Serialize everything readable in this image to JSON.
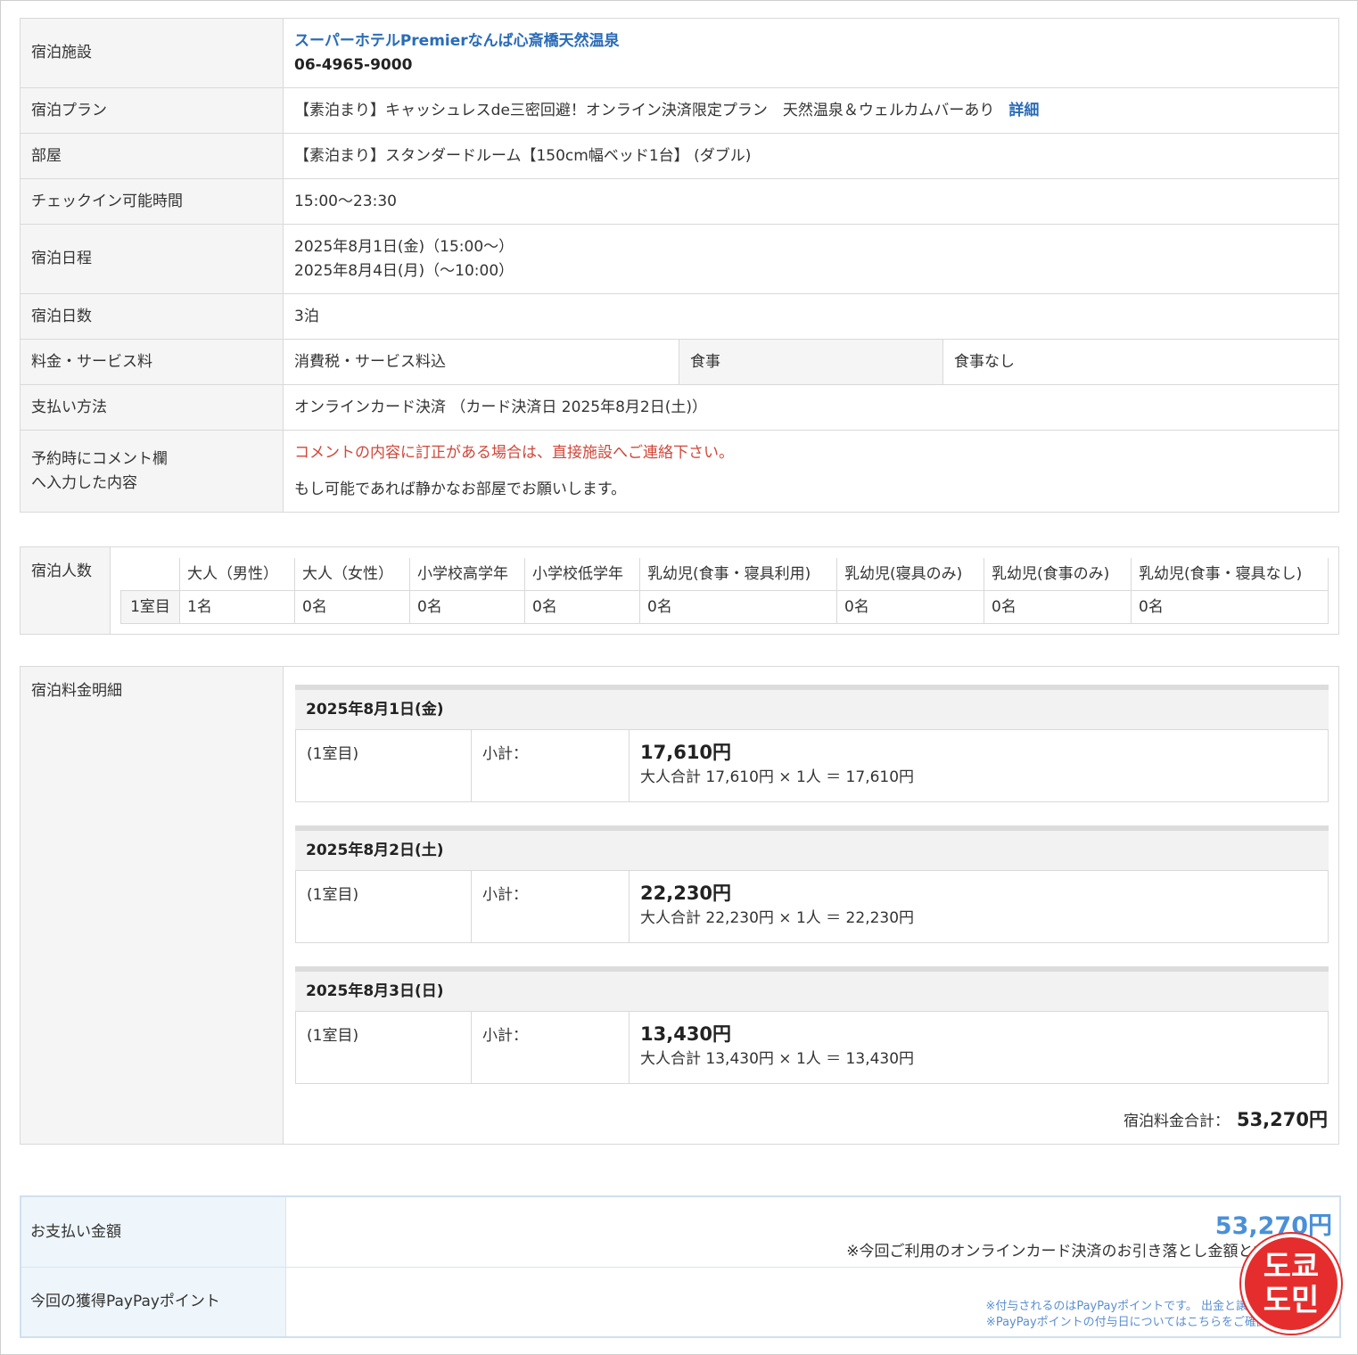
{
  "info": {
    "facility_label": "宿泊施設",
    "hotel_name": "スーパーホテルPremierなんば心斎橋天然温泉",
    "hotel_tel": "06-4965-9000",
    "plan_label": "宿泊プラン",
    "plan_value": "【素泊まり】キャッシュレスde三密回避！オンライン決済限定プラン　天然温泉＆ウェルカムバーあり",
    "plan_detail_link": "詳細",
    "room_label": "部屋",
    "room_value": "【素泊まり】スタンダードルーム【150cm幅ベッド1台】 (ダブル)",
    "checkin_label": "チェックイン可能時間",
    "checkin_value": "15:00～23:30",
    "schedule_label": "宿泊日程",
    "schedule_start": "2025年8月1日(金)（15:00～）",
    "schedule_end": "2025年8月4日(月)（～10:00）",
    "nights_label": "宿泊日数",
    "nights_value": "3泊",
    "fee_label": "料金・サービス料",
    "fee_value": "消費税・サービス料込",
    "meal_label": "食事",
    "meal_value": "食事なし",
    "payment_label": "支払い方法",
    "payment_value": "オンラインカード決済 （カード決済日 2025年8月2日(土)）",
    "comment_label_1": "予約時にコメント欄",
    "comment_label_2": "へ入力した内容",
    "comment_warning": "コメントの内容に訂正がある場合は、直接施設へご連絡下さい。",
    "comment_value": "もし可能であれば静かなお部屋でお願いします。"
  },
  "guests": {
    "label": "宿泊人数",
    "headers": [
      "大人（男性）",
      "大人（女性）",
      "小学校高学年",
      "小学校低学年",
      "乳幼児(食事・寝具利用)",
      "乳幼児(寝具のみ)",
      "乳幼児(食事のみ)",
      "乳幼児(食事・寝具なし)"
    ],
    "room_label": "1室目",
    "values": [
      "1名",
      "0名",
      "0名",
      "0名",
      "0名",
      "0名",
      "0名",
      "0名"
    ]
  },
  "fees": {
    "label": "宿泊料金明細",
    "days": [
      {
        "date": "2025年8月1日(金)",
        "room": "(1室目)",
        "subtotal_label": "小計：",
        "amount": "17,610円",
        "calc": "大人合計 17,610円 × 1人 ＝ 17,610円"
      },
      {
        "date": "2025年8月2日(土)",
        "room": "(1室目)",
        "subtotal_label": "小計：",
        "amount": "22,230円",
        "calc": "大人合計 22,230円 × 1人 ＝ 22,230円"
      },
      {
        "date": "2025年8月3日(日)",
        "room": "(1室目)",
        "subtotal_label": "小計：",
        "amount": "13,430円",
        "calc": "大人合計 13,430円 × 1人 ＝ 13,430円"
      }
    ],
    "total_label": "宿泊料金合計：",
    "total_value": "53,270円"
  },
  "payment": {
    "amount_label": "お支払い金額",
    "amount_value": "53,270円",
    "amount_note": "※今回ご利用のオンラインカード決済のお引き落とし金額とな",
    "points_label": "今回の獲得PayPayポイント",
    "points_note_1": "※付与されるのはPayPayポイントです。 出金と譲渡",
    "points_note_2": "※PayPayポイントの付与日についてはこちらをご確認",
    "points_note_link": "こちら"
  },
  "stamp": {
    "line1": "도쿄",
    "line2": "도민",
    "color": "#e52d2d"
  },
  "colors": {
    "link": "#2a6cb8",
    "warning": "#d0473a",
    "accent": "#4a90d9"
  }
}
